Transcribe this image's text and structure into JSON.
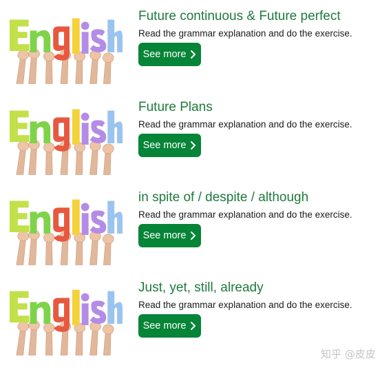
{
  "lessons": [
    {
      "title": "Future continuous & Future perfect",
      "description": "Read the grammar explanation and do the exercise.",
      "button_label": "See more"
    },
    {
      "title": "Future Plans",
      "description": "Read the grammar explanation and do the exercise.",
      "button_label": "See more"
    },
    {
      "title": "in spite of / despite / although",
      "description": "Read the grammar explanation and do the exercise.",
      "button_label": "See more"
    },
    {
      "title": "Just, yet, still, already",
      "description": "Read the grammar explanation and do the exercise.",
      "button_label": "See more"
    }
  ],
  "thumbnail": {
    "logo_text": "English",
    "letter_colors": [
      "#c2e04a",
      "#7fd34a",
      "#e8573f",
      "#f4d23a",
      "#b48ce6",
      "#9ac4ef"
    ]
  },
  "colors": {
    "title": "#1e7a3c",
    "button_bg": "#068437",
    "button_text": "#ffffff"
  },
  "watermark": "知乎 @皮皮"
}
